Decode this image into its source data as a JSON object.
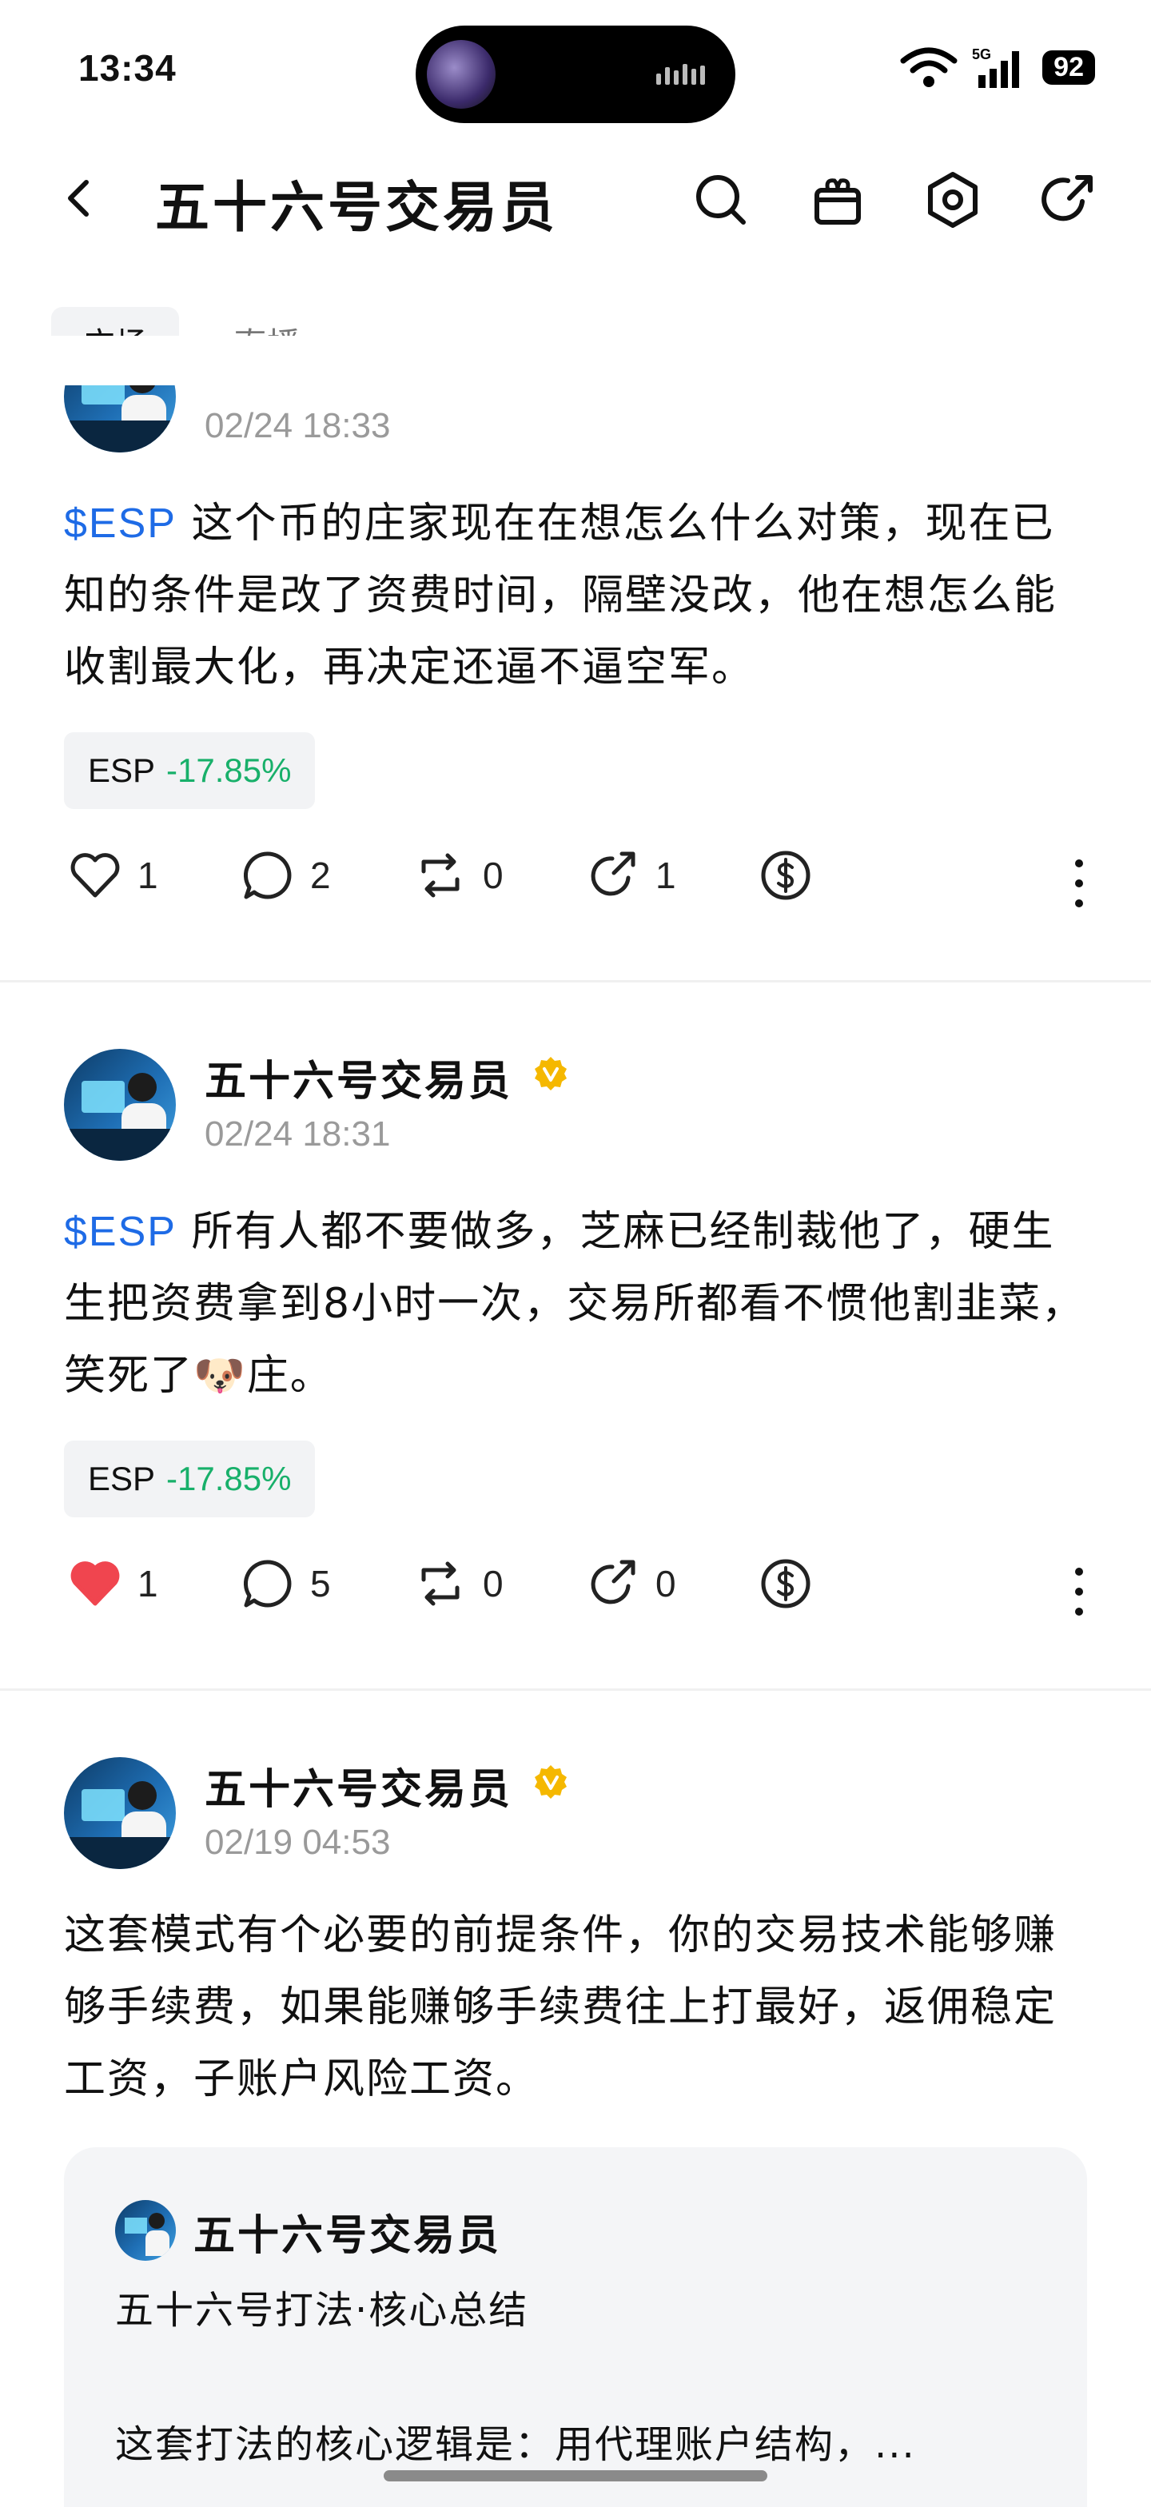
{
  "status": {
    "time": "13:34",
    "network": "5G",
    "battery": "92"
  },
  "header": {
    "title": "五十六号交易员"
  },
  "tabs": [
    {
      "label": "广场"
    },
    {
      "label": "直播"
    }
  ],
  "posts": [
    {
      "time": "02/24 18:33",
      "ticker": "$ESP",
      "text": " 这个币的庄家现在在想怎么什么对策，现在已知的条件是改了资费时间，隔壁没改，他在想怎么能收割最大化，再决定还逼不逼空军。",
      "chip": {
        "symbol": "ESP",
        "change": "-17.85%"
      },
      "stats": {
        "likes": "1",
        "comments": "2",
        "reposts": "0",
        "shares": "1"
      },
      "liked": false
    },
    {
      "author": "五十六号交易员",
      "time": "02/24 18:31",
      "ticker": "$ESP",
      "text": " 所有人都不要做多，芝麻已经制裁他了，硬生生把资费拿到8小时一次，交易所都看不惯他割韭菜，笑死了🐶庄。",
      "chip": {
        "symbol": "ESP",
        "change": "-17.85%"
      },
      "stats": {
        "likes": "1",
        "comments": "5",
        "reposts": "0",
        "shares": "0"
      },
      "liked": true
    },
    {
      "author": "五十六号交易员",
      "time": "02/19 04:53",
      "text": "这套模式有个必要的前提条件，你的交易技术能够赚够手续费，如果能赚够手续费往上打最好，返佣稳定工资，子账户风险工资。",
      "quote": {
        "author": "五十六号交易员",
        "title": "五十六号打法·核心总结",
        "body": "这套打法的核心逻辑是：用代理账户结构，..."
      }
    }
  ],
  "colors": {
    "accent": "#1e6be6",
    "positive": "#18b06a",
    "like": "#f0454f",
    "verified": "#f5b800"
  }
}
